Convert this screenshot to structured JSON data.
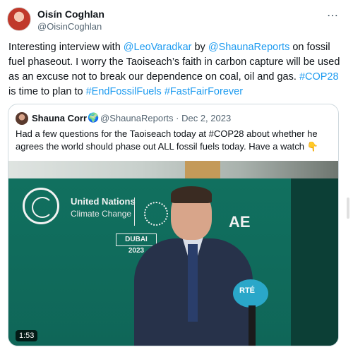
{
  "tweet": {
    "author_name": "Oisín Coghlan",
    "author_handle": "@OisinCoghlan",
    "more_icon": "⋯",
    "text_parts": {
      "p1": "Interesting interview with ",
      "mention1": "@LeoVaradkar",
      "p2": " by ",
      "mention2": "@ShaunaReports",
      "p3": " on fossil fuel phaseout. I worry the Taoiseach’s faith in carbon capture will be used as an excuse not to break our dependence on coal, oil and gas. ",
      "hashtag1": "#COP28",
      "p4": " is time to plan to ",
      "hashtag2": "#EndFossilFuels",
      "p5": " ",
      "hashtag3": "#FastFairForever"
    }
  },
  "quote": {
    "author_name": "Shauna Corr",
    "globe_icon": "🌍",
    "handle_date": "@ShaunaReports · Dec 2, 2023",
    "text": "Had a few questions for the Taoiseach today at #COP28 about whether he agrees the world should phase out ALL fossil fuels today. Have a watch 👇",
    "video": {
      "duration": "1:53",
      "backdrop_title": "United Nations",
      "backdrop_subtitle": "Climate Change",
      "backdrop_tag": "DUBAI 2023",
      "backdrop_ae": "AE",
      "mic_label": "RTÉ"
    }
  },
  "colors": {
    "link": "#1d9bf0",
    "text": "#0f1419",
    "muted": "#536471",
    "border": "#cfd9de"
  }
}
